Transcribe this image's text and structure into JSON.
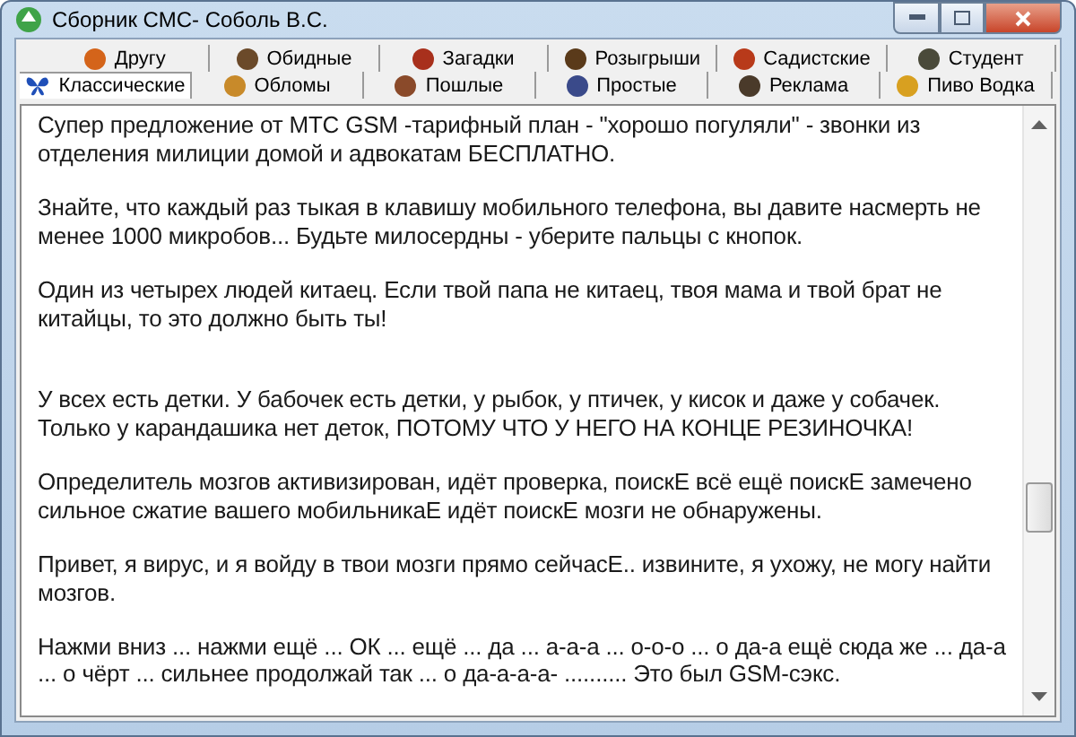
{
  "window": {
    "title": "Сборник СМС- Соболь В.С."
  },
  "tab_rows": [
    [
      {
        "label": "Другу",
        "selected": false,
        "color": "#d4641a"
      },
      {
        "label": "Обидные",
        "selected": false,
        "color": "#6b4a2a"
      },
      {
        "label": "Загадки",
        "selected": false,
        "color": "#a8301c"
      },
      {
        "label": "Розыгрыши",
        "selected": false,
        "color": "#5a3a1a"
      },
      {
        "label": "Садистские",
        "selected": false,
        "color": "#b83a1a"
      },
      {
        "label": "Студент",
        "selected": false,
        "color": "#4a4a3a"
      }
    ],
    [
      {
        "label": "Классические",
        "selected": true,
        "color": "#1f4fb8"
      },
      {
        "label": "Обломы",
        "selected": false,
        "color": "#c88a2a"
      },
      {
        "label": "Пошлые",
        "selected": false,
        "color": "#8a4a2a"
      },
      {
        "label": "Простые",
        "selected": false,
        "color": "#3a4a8a"
      },
      {
        "label": "Реклама",
        "selected": false,
        "color": "#4a3a2a"
      },
      {
        "label": "Пиво Водка",
        "selected": false,
        "color": "#d8a020"
      }
    ]
  ],
  "messages": [
    {
      "kind": "text",
      "text": "Супер предложение от МТС GSM -тарифный план - \"хорошо погуляли\" - звонки из отделения милиции домой и адвокатам БЕСПЛАТНО."
    },
    {
      "kind": "text",
      "text": "Знайте, что каждый раз тыкая в клавишу мобильного телефона, вы давите насмерть не менее 1000 микробов... Будьте милосердны - уберите пальцы с кнопок."
    },
    {
      "kind": "text",
      "text": "Один из четырех людей китаец. Если твой папа не китаец, твоя мама и твой брат не китайцы, то это должно быть ты!"
    },
    {
      "kind": "blank"
    },
    {
      "kind": "text",
      "text": "У всех есть детки. У бабочек есть детки, у рыбок, у птичек, у кисок и даже у собачек. Только у карандашика нет деток, ПОТОМУ ЧТО У НЕГО НА КОНЦЕ РЕЗИНОЧКА!"
    },
    {
      "kind": "text",
      "text": "Определитель мозгов активизирован, идёт проверка, поискЕ всё ещё поискЕ замечено сильное сжатие вашего мобильникаЕ идёт поискЕ мозги не обнаружены."
    },
    {
      "kind": "text",
      "text": "Привет, я вирус, и я войду в твои мозги прямо сейчасЕ.. извините, я ухожу, не могу найти мозгов."
    },
    {
      "kind": "text",
      "text": "Нажми вниз ... нажми ещё ... ОК ... ещё ... да ... а-а-а ... о-о-о ... о да-а ещё сюда же ... да-а ... о чёрт ... сильнее продолжай так ... о да-а-а-а- .......... Это был GSM-сэкс."
    }
  ]
}
